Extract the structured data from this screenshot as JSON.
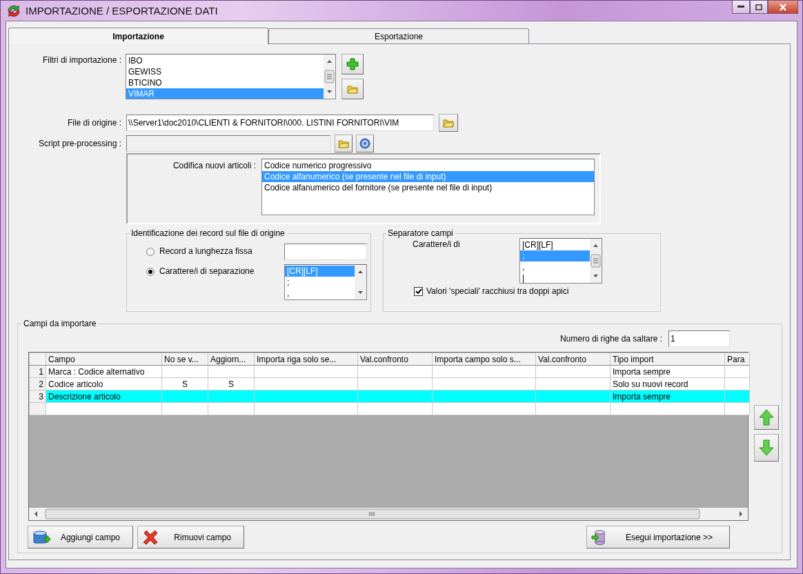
{
  "window": {
    "title": "IMPORTAZIONE / ESPORTAZIONE DATI"
  },
  "tabs": [
    {
      "label": "Importazione",
      "selected": true
    },
    {
      "label": "Esportazione",
      "selected": false
    }
  ],
  "import_filters": {
    "label": "Filtri di importazione :",
    "items": [
      {
        "label": "IBO",
        "selected": false
      },
      {
        "label": "GEWISS",
        "selected": false
      },
      {
        "label": "BTICINO",
        "selected": false
      },
      {
        "label": "VIMAR",
        "selected": true
      }
    ]
  },
  "source_file": {
    "label": "File di origine :",
    "value": "\\\\Server1\\doc2010\\CLIENTI & FORNITORI\\000. LISTINI FORNITORI\\VIM"
  },
  "preprocessing_script": {
    "label": "Script pre-processing :",
    "disabled": true
  },
  "new_article_coding": {
    "label": "Codifica nuovi articoli :",
    "items": [
      {
        "label": "Codice numerico progressivo",
        "selected": false
      },
      {
        "label": "Codice alfanumerico (se presente nel file di input)",
        "selected": true
      },
      {
        "label": "Codice alfanumerico del fornitore (se presente nel file di input)",
        "selected": false
      }
    ]
  },
  "record_identification": {
    "title": "Identificazione dei record sul file di origine",
    "options": [
      {
        "label": "Record a lunghezza fissa",
        "selected": false,
        "kind": "field"
      },
      {
        "label": "Carattere/i di separazione",
        "selected": true,
        "kind": "list",
        "items": [
          {
            "label": "[CR][LF]",
            "selected": true
          },
          {
            "label": ";",
            "selected": false
          },
          {
            "label": ",",
            "selected": false
          }
        ]
      }
    ]
  },
  "field_separator": {
    "title": "Separatore campi",
    "label": "Carattere/i di",
    "items": [
      {
        "label": "[CR][LF]",
        "selected": false
      },
      {
        "label": ";",
        "selected": true
      },
      {
        "label": ",",
        "selected": false
      },
      {
        "label": "|",
        "selected": false
      }
    ],
    "quoted_values": {
      "label": "Valori 'speciali' racchiusi tra doppi apici",
      "checked": true
    }
  },
  "fields_to_import": {
    "title": "Campi da importare",
    "skip_rows": {
      "label": "Numero di righe da saltare :",
      "value": "1"
    },
    "table": {
      "columns": [
        "Campo",
        "No se v...",
        "Aggiorn...",
        "Importa riga solo se...",
        "Val.confronto",
        "Importa campo solo s...",
        "Val.confronto",
        "Tipo import",
        "Para"
      ],
      "rows": [
        {
          "number": "1",
          "selected": false,
          "cells": [
            "Marca : Codice alternativo",
            null,
            null,
            null,
            null,
            null,
            null,
            "Importa sempre",
            null
          ]
        },
        {
          "number": "2",
          "selected": false,
          "cells": [
            "Codice articolo",
            "S",
            "S",
            null,
            null,
            null,
            null,
            "Solo su nuovi record",
            null
          ]
        },
        {
          "number": "3",
          "selected": true,
          "cells": [
            "Descrizione articolo",
            null,
            null,
            null,
            null,
            null,
            null,
            "Importa sempre",
            null
          ]
        }
      ]
    }
  },
  "buttons": [
    {
      "label": "Aggiungi campo",
      "kind": "add"
    },
    {
      "label": "Rimuovi campo",
      "kind": "remove"
    },
    {
      "label": "Esegui importazione >>",
      "kind": "run"
    }
  ]
}
